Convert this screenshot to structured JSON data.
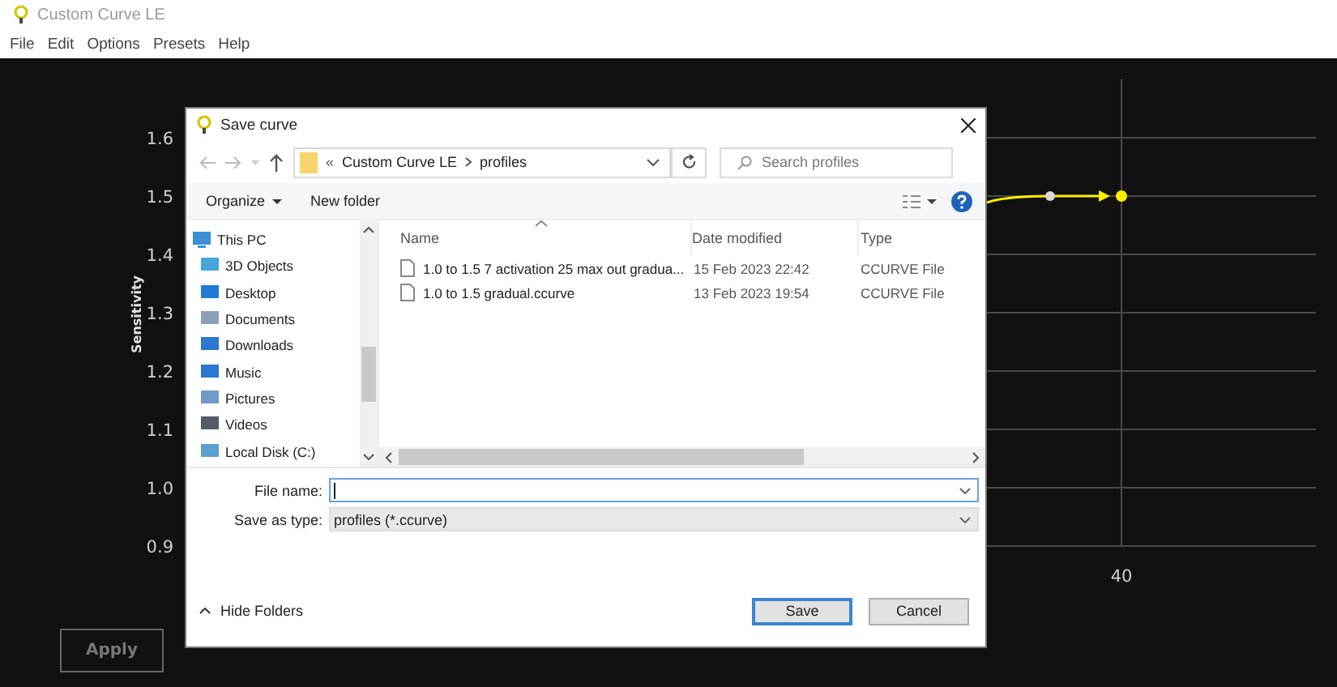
{
  "app": {
    "title": "Custom Curve LE"
  },
  "menu": [
    "File",
    "Edit",
    "Options",
    "Presets",
    "Help"
  ],
  "chart": {
    "y_axis_title": "Sensitivity",
    "y_axis_labels": [
      "1.6",
      "1.5",
      "1.4",
      "1.3",
      "1.2",
      "1.1",
      "1.0",
      "0.9"
    ],
    "x_axis_label": "40"
  },
  "apply_button": {
    "label": "Apply",
    "disabled": true
  },
  "dialog": {
    "title": "Save curve",
    "address": {
      "overflow": "«",
      "parts": [
        "Custom Curve LE",
        "profiles"
      ]
    },
    "search": {
      "placeholder": "Search profiles"
    },
    "toolbar": {
      "organize": "Organize",
      "new_folder": "New folder"
    },
    "tree": [
      {
        "label": "This PC",
        "kind": "pc"
      },
      {
        "label": "3D Objects",
        "kind": "objects"
      },
      {
        "label": "Desktop",
        "kind": "desktop"
      },
      {
        "label": "Documents",
        "kind": "documents"
      },
      {
        "label": "Downloads",
        "kind": "downloads"
      },
      {
        "label": "Music",
        "kind": "music"
      },
      {
        "label": "Pictures",
        "kind": "pictures"
      },
      {
        "label": "Videos",
        "kind": "videos"
      },
      {
        "label": "Local Disk (C:)",
        "kind": "disk"
      }
    ],
    "columns": [
      "Name",
      "Date modified",
      "Type"
    ],
    "files": [
      {
        "name": "1.0 to 1.5  7 activation 25 max out gradua...",
        "date": "15 Feb 2023 22:42",
        "type": "CCURVE File"
      },
      {
        "name": "1.0 to 1.5 gradual.ccurve",
        "date": "13 Feb 2023 19:54",
        "type": "CCURVE File"
      }
    ],
    "file_name": {
      "label": "File name:"
    },
    "save_type": {
      "label": "Save as type:",
      "value": "profiles (*.ccurve)"
    },
    "hide_folders": "Hide Folders",
    "buttons": [
      {
        "label": "Save",
        "default": true
      },
      {
        "label": "Cancel",
        "default": false
      }
    ]
  }
}
